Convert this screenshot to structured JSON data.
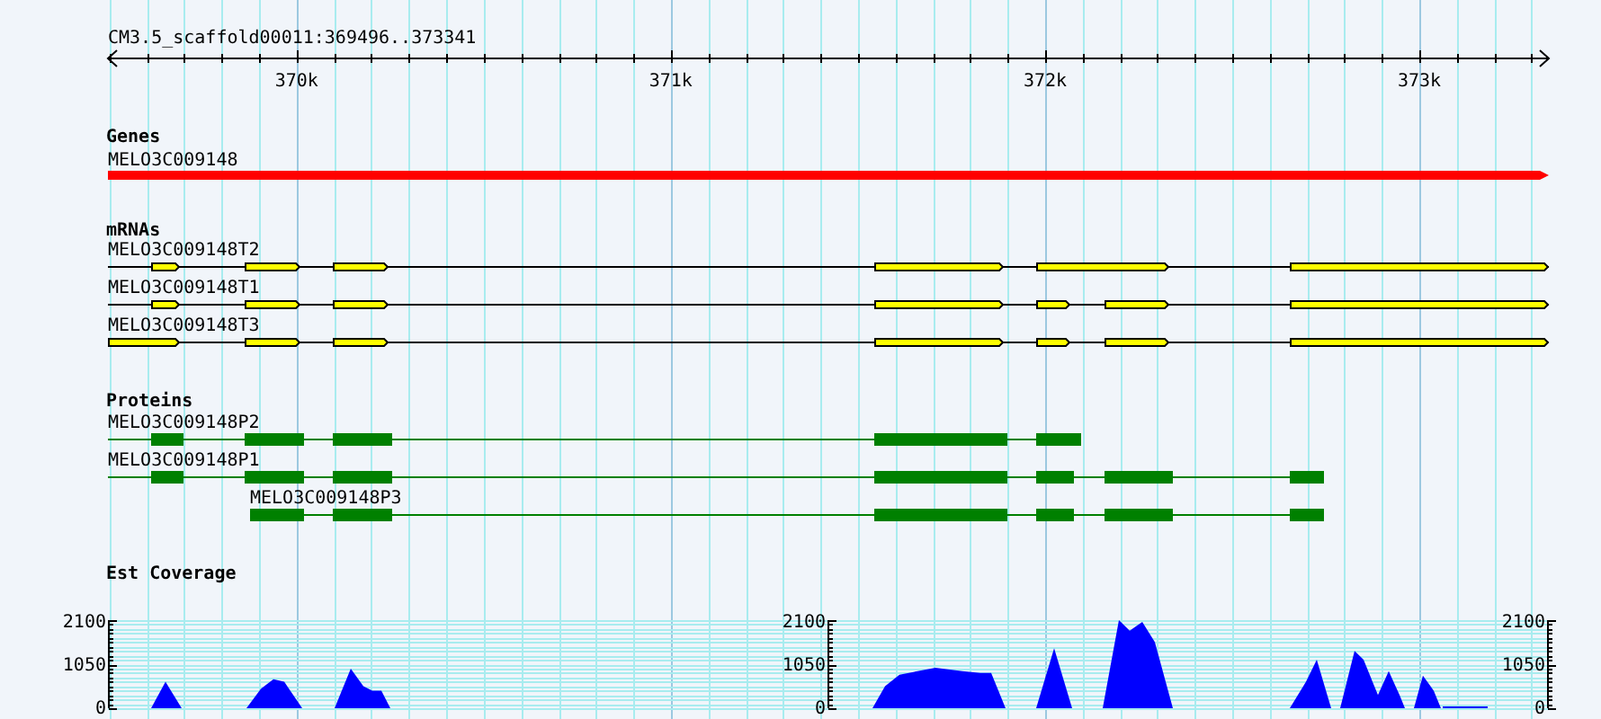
{
  "ruler": {
    "title": "CM3.5_scaffold00011:369496..373341",
    "labels": [
      "370k",
      "371k",
      "372k",
      "373k"
    ]
  },
  "tracks": [
    {
      "kind": "gene",
      "label": "Genes",
      "features": [
        {
          "name": "MELO3C009148"
        }
      ]
    },
    {
      "kind": "mrna",
      "label": "mRNAs",
      "features": [
        {
          "name": "MELO3C009148T2"
        },
        {
          "name": "MELO3C009148T1"
        },
        {
          "name": "MELO3C009148T3"
        }
      ]
    },
    {
      "kind": "protein",
      "label": "Proteins",
      "features": [
        {
          "name": "MELO3C009148P2"
        },
        {
          "name": "MELO3C009148P1"
        },
        {
          "name": "MELO3C009148P3"
        }
      ]
    },
    {
      "kind": "coverage",
      "label": "Est Coverage",
      "axes": [
        {
          "labels": [
            "2100",
            "1050",
            "0"
          ]
        },
        {
          "labels": [
            "2100",
            "1050",
            "0"
          ]
        },
        {
          "labels": [
            "2100",
            "1050",
            "0"
          ]
        }
      ]
    }
  ]
}
